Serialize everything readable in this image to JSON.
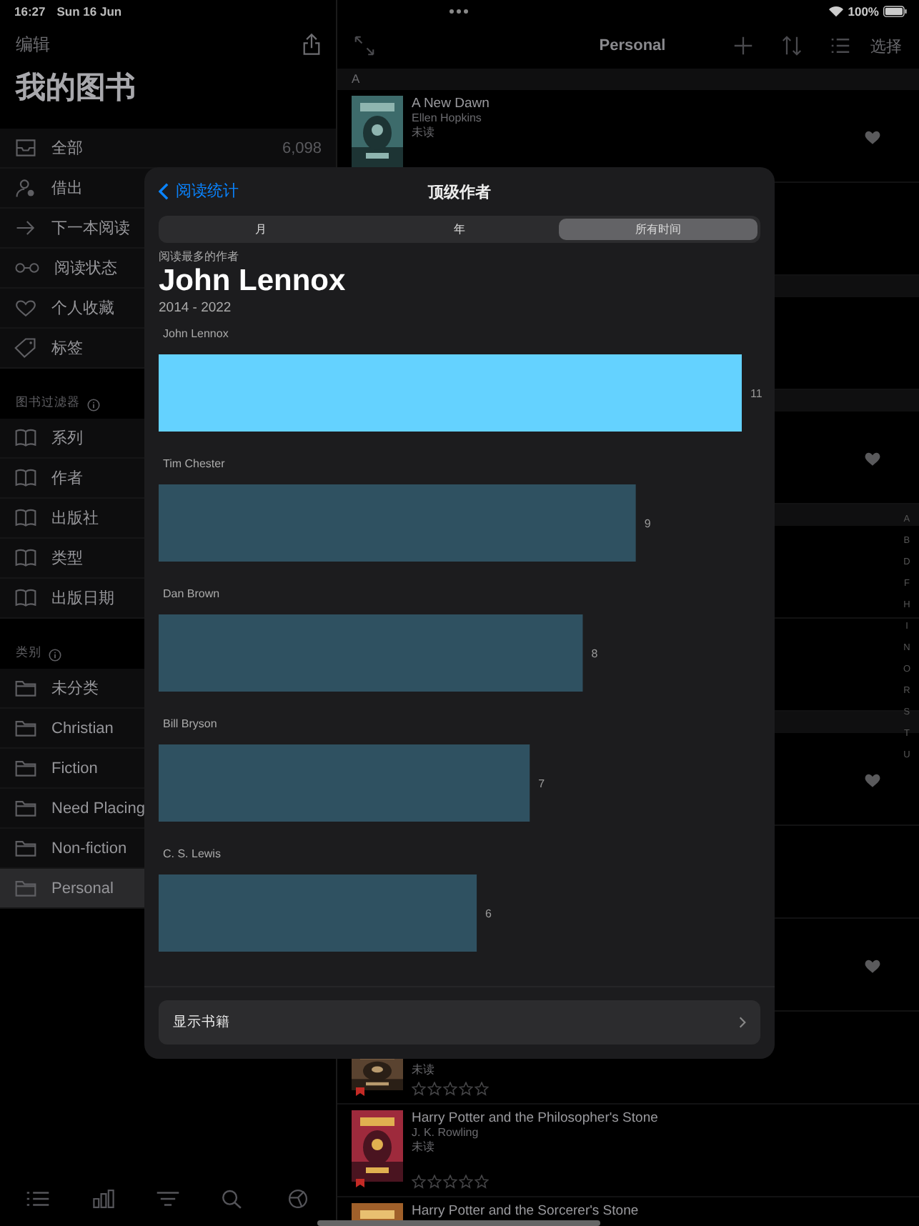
{
  "status_bar": {
    "time": "16:27",
    "date": "Sun 16 Jun",
    "battery": "100%"
  },
  "sidebar": {
    "edit": "编辑",
    "title": "我的图书",
    "groups": [
      {
        "items": [
          {
            "label": "全部",
            "kind": "tray",
            "count": "6,098",
            "selected": false
          },
          {
            "label": "借出",
            "kind": "person",
            "selected": false
          },
          {
            "label": "下一本阅读",
            "kind": "arrow",
            "selected": false
          },
          {
            "label": "阅读状态",
            "kind": "glasses",
            "selected": false
          },
          {
            "label": "个人收藏",
            "kind": "heart",
            "selected": false
          },
          {
            "label": "标签",
            "kind": "tag",
            "selected": false
          }
        ]
      },
      {
        "header": "图书过滤器",
        "items": [
          {
            "label": "系列",
            "kind": "book",
            "selected": false
          },
          {
            "label": "作者",
            "kind": "book",
            "selected": false
          },
          {
            "label": "出版社",
            "kind": "book",
            "selected": false
          },
          {
            "label": "类型",
            "kind": "book",
            "selected": false
          },
          {
            "label": "出版日期",
            "kind": "book",
            "selected": false
          }
        ]
      },
      {
        "header": "类别",
        "items": [
          {
            "label": "未分类",
            "kind": "folder",
            "selected": false
          },
          {
            "label": "Christian",
            "kind": "folder",
            "selected": false
          },
          {
            "label": "Fiction",
            "kind": "folder",
            "selected": false
          },
          {
            "label": "Need Placing",
            "kind": "folder",
            "selected": false
          },
          {
            "label": "Non-fiction",
            "kind": "folder",
            "selected": false
          },
          {
            "label": "Personal",
            "kind": "folder",
            "selected": true
          }
        ]
      }
    ]
  },
  "list": {
    "title": "Personal",
    "select": "选择",
    "rows": [
      {
        "kind": "section",
        "label": "A"
      },
      {
        "kind": "book",
        "title": "A New Dawn",
        "author": "Ellen Hopkins",
        "status": "未读",
        "favorite": true,
        "bookmark": false
      },
      {
        "kind": "row",
        "favorite": false
      },
      {
        "kind": "section"
      },
      {
        "kind": "row",
        "favorite": false
      },
      {
        "kind": "section"
      },
      {
        "kind": "row",
        "favorite": true
      },
      {
        "kind": "section"
      },
      {
        "kind": "row",
        "favorite": false
      },
      {
        "kind": "row",
        "favorite": false
      },
      {
        "kind": "section"
      },
      {
        "kind": "row",
        "favorite": true
      },
      {
        "kind": "row",
        "favorite": false
      },
      {
        "kind": "row",
        "favorite": true
      },
      {
        "kind": "book",
        "status": "未读",
        "stars": 0,
        "favorite": false,
        "bookmark": true
      },
      {
        "kind": "book",
        "title": "Harry Potter and the Philosopher's Stone",
        "author": "J. K. Rowling",
        "status": "未读",
        "stars": 0,
        "favorite": false,
        "bookmark": true
      },
      {
        "kind": "book",
        "title": "Harry Potter and the Sorcerer's Stone",
        "favorite": false,
        "bookmark": false
      }
    ]
  },
  "index_letters": [
    "A",
    "B",
    "D",
    "F",
    "H",
    "I",
    "N",
    "O",
    "R",
    "S",
    "T",
    "U"
  ],
  "modal": {
    "back": "阅读统计",
    "title": "顶级作者",
    "segments": [
      {
        "label": "月",
        "selected": false
      },
      {
        "label": "年",
        "selected": false
      },
      {
        "label": "所有时间",
        "selected": true
      }
    ],
    "caption": "阅读最多的作者",
    "top_author": "John Lennox",
    "years": "2014 - 2022",
    "chart_data": {
      "type": "bar",
      "orientation": "horizontal",
      "categories": [
        "John Lennox",
        "Tim Chester",
        "Dan Brown",
        "Bill Bryson",
        "C. S. Lewis"
      ],
      "series": [
        {
          "color": "#64d2ff",
          "values": [
            11,
            null,
            null,
            null,
            null
          ]
        },
        {
          "color": "#2f5161",
          "values": [
            null,
            9,
            8,
            7,
            6
          ]
        }
      ],
      "stacked": true,
      "data_labels": true
    },
    "show_books": "显示书籍"
  }
}
